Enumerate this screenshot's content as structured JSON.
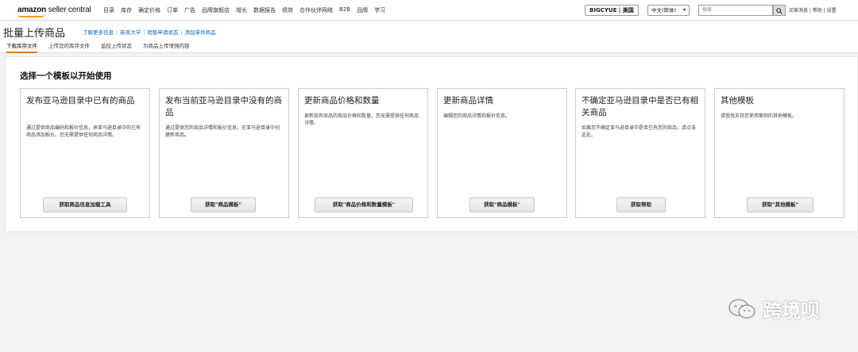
{
  "brand": {
    "logo_bold": "amazon",
    "logo_light": " seller central"
  },
  "nav": [
    "目录",
    "库存",
    "确定价格",
    "订单",
    "广告",
    "品牌旗舰店",
    "增长",
    "数据报告",
    "绩效",
    "合作伙伴网络",
    "B2B",
    "品牌",
    "学习"
  ],
  "store_button": "BIGCYUE | 美国",
  "language": {
    "selected": "中文(简体)",
    "caret": "▾"
  },
  "search": {
    "placeholder": "搜索",
    "icon": "search-icon"
  },
  "top_links": "买家消息 | 帮助 | 设置",
  "page": {
    "title": "批量上传商品",
    "links": [
      "了解更多信息",
      "新卖大学",
      "销售申请状态",
      "添加单件商品"
    ],
    "tabs": [
      "下载库存文件",
      "上传您的库存文件",
      "监控上传状态",
      "为商品上传增强内容"
    ]
  },
  "section_title": "选择一个模板以开始使用",
  "cards": [
    {
      "title": "发布亚马逊目录中已有的商品",
      "desc": "通过提供商品编码和报价信息，来亚马逊目录中的已有商品添加报价。您无需提供任何商品详情。",
      "button": "获取商品信息加载工具"
    },
    {
      "title": "发布当前亚马逊目录中没有的商品",
      "desc": "通过提供您的商品详情和报价信息，在亚马逊目录中创建新商品。",
      "button": "获取\"商品模板\""
    },
    {
      "title": "更新商品价格和数量",
      "desc": "更新现有商品的商品价格和数量。您无需提供任何商品详情。",
      "button": "获取\"商品价格和数量模板\""
    },
    {
      "title": "更新商品详情",
      "desc": "编辑您的商品详情和报价信息。",
      "button": "获取\"商品模板\""
    },
    {
      "title": "不确定亚马逊目录中是否已有相关商品",
      "desc": "如果您不确定亚马逊目录中是否已有您的商品，请点击此处。",
      "button": "获取帮助"
    },
    {
      "title": "其他模板",
      "desc": "请查找支持您使用案例的其他模板。",
      "button": "获取\"其他模板\""
    }
  ],
  "watermark": {
    "text": "跨境呗",
    "icon": "wechat-icon"
  }
}
